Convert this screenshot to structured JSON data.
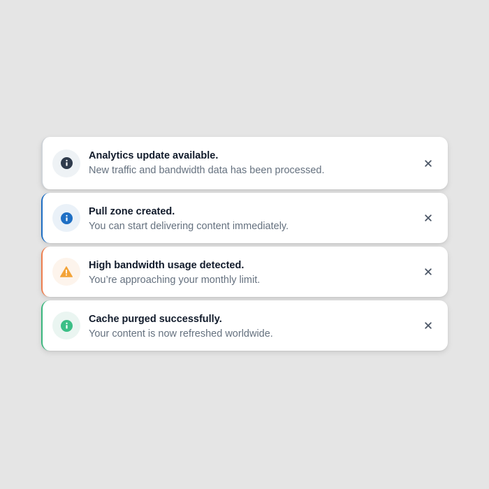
{
  "toasts": [
    {
      "title": "Analytics update available.",
      "message": "New traffic and bandwidth data has been processed.",
      "icon": "info-circle-icon",
      "accent": "#2f3b4c"
    },
    {
      "title": "Pull zone created.",
      "message": "You can start delivering content immediately.",
      "icon": "info-circle-icon",
      "accent": "#1f6fc4"
    },
    {
      "title": "High bandwidth usage detected.",
      "message": "You’re approaching your monthly limit.",
      "icon": "warning-triangle-icon",
      "accent": "#f3a338"
    },
    {
      "title": "Cache purged successfully.",
      "message": "Your content is now refreshed worldwide.",
      "icon": "info-circle-icon",
      "accent": "#3bbf86"
    }
  ]
}
